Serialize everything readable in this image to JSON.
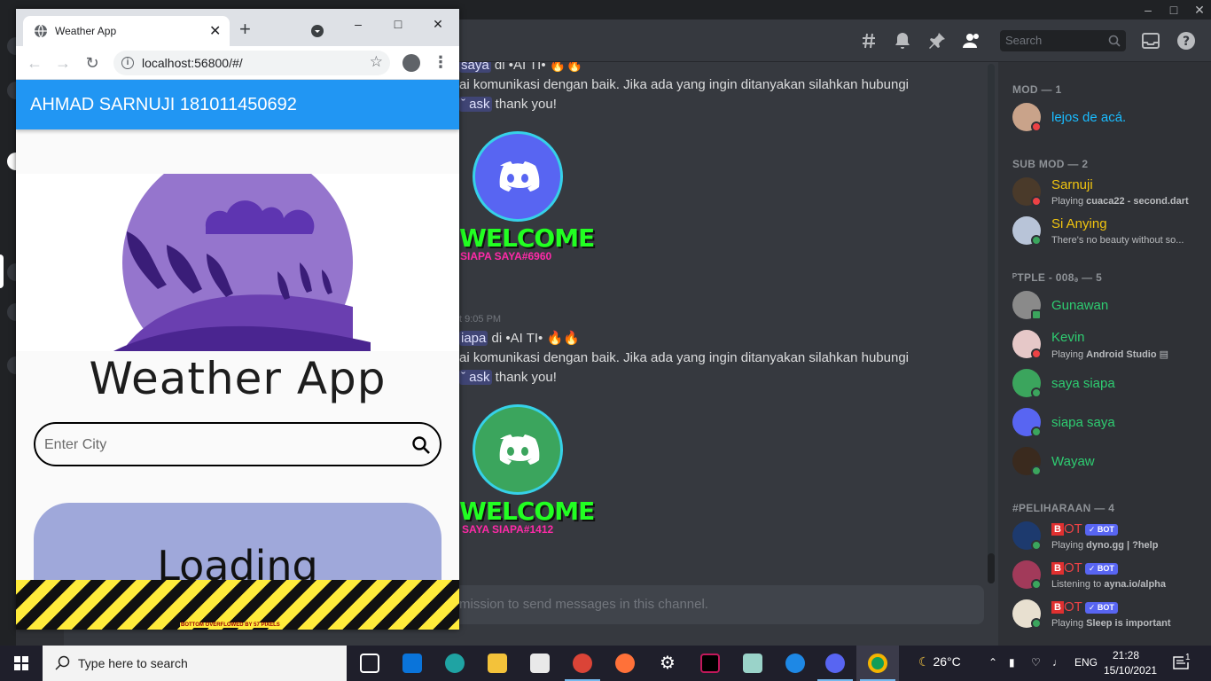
{
  "discord": {
    "search_placeholder": "Search",
    "messages": {
      "msg1_prefix": "saya",
      "msg1_suffix": " di •AI TI• 🔥🔥",
      "msg1_line2": "ai komunikasi dengan baik.  Jika ada yang ingin ditanyakan silahkan hubungi",
      "msg1_ask": "ˇ ask",
      "msg1_thanks": " thank you!",
      "welcome1_title": "WELCOME",
      "welcome1_sub": "SIAPA SAYA#6960",
      "timestamp2": "t 9:05 PM",
      "msg2_prefix": "iapa",
      "msg2_suffix": " di •AI TI• 🔥🔥",
      "msg2_line2": "ai komunikasi dengan baik.  Jika ada yang ingin ditanyakan silahkan hubungi",
      "msg2_ask": "ˇ ask",
      "msg2_thanks": " thank you!",
      "welcome2_title": "WELCOME",
      "welcome2_sub": "SAYA SIAPA#1412"
    },
    "input_placeholder": "mission to send messages in this channel.",
    "members": {
      "cat_mod": "MOD — 1",
      "cat_submod": "SUB MOD — 2",
      "cat_tple": "ᴾTPLE - 008ₔ — 5",
      "cat_peliharaan": "#PELIHARAAN — 4",
      "mod": [
        {
          "name": "lejos de acá.",
          "color": "#1abcff",
          "status": "#ed4245"
        }
      ],
      "submod": [
        {
          "name": "Sarnuji",
          "activity_prefix": "Playing ",
          "activity": "cuaca22 - second.dart",
          "color": "#f1c40f",
          "status": "#ed4245"
        },
        {
          "name": "Si Anying",
          "activity_prefix": "",
          "activity": "There's no beauty without so...",
          "color": "#f1c40f",
          "status": "#3ba55d"
        }
      ],
      "tple": [
        {
          "name": "Gunawan",
          "activity_prefix": "",
          "activity": "",
          "color": "#2ecc71",
          "status": "#3ba55d"
        },
        {
          "name": "Kevin",
          "activity_prefix": "Playing ",
          "activity": "Android Studio",
          "color": "#2ecc71",
          "status": "#ed4245"
        },
        {
          "name": "saya siapa",
          "activity_prefix": "",
          "activity": "",
          "color": "#2ecc71",
          "status": "#3ba55d"
        },
        {
          "name": "siapa saya",
          "activity_prefix": "",
          "activity": "",
          "color": "#2ecc71",
          "status": "#3ba55d"
        },
        {
          "name": "Wayaw",
          "activity_prefix": "",
          "activity": "",
          "color": "#2ecc71",
          "status": "#3ba55d"
        }
      ],
      "bots": [
        {
          "badge": "B",
          "name": "OT",
          "tag": "✓ BOT",
          "activity_prefix": "Playing ",
          "activity": "dyno.gg | ?help"
        },
        {
          "badge": "B",
          "name": "OT",
          "tag": "✓ BOT",
          "activity_prefix": "Listening to ",
          "activity": "ayna.io/alpha"
        },
        {
          "badge": "B",
          "name": "OT",
          "tag": "✓ BOT",
          "activity_prefix": "Playing ",
          "activity": "Sleep is important"
        }
      ]
    }
  },
  "chrome": {
    "tab_title": "Weather App",
    "url": "localhost:56800/#/"
  },
  "app": {
    "appbar_title": "AHMAD SARNUJI 181011450692",
    "heading": "Weather App",
    "city_placeholder": "Enter City",
    "loading_text": "Loading",
    "overflow_text": "BOTTOM OVERFLOWED BY 57 PIXELS"
  },
  "taskbar": {
    "search_placeholder": "Type here to search",
    "temperature": "26°C",
    "language": "ENG",
    "time": "21:28",
    "date": "15/10/2021",
    "notifications": "1"
  }
}
